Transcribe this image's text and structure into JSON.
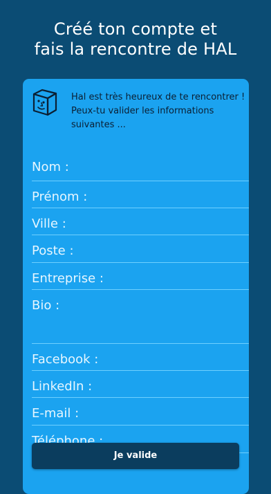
{
  "header": {
    "line1": "Créé ton compte et",
    "line2": "fais la rencontre de HAL"
  },
  "card": {
    "icon": "hal-cube-face-icon",
    "intro": "Hal est très heureux de te rencontrer ! Peux-tu valider les informations suivantes ...",
    "fields": [
      {
        "label": "Nom :",
        "value": ""
      },
      {
        "label": "Prénom :",
        "value": ""
      },
      {
        "label": "Ville :",
        "value": ""
      },
      {
        "label": "Poste :",
        "value": ""
      },
      {
        "label": "Entreprise :",
        "value": ""
      },
      {
        "label": "Bio :",
        "value": ""
      },
      {
        "label": "Facebook :",
        "value": ""
      },
      {
        "label": "LinkedIn :",
        "value": ""
      },
      {
        "label": "E-mail :",
        "value": ""
      },
      {
        "label": "Téléphone :",
        "value": ""
      }
    ]
  },
  "submit": {
    "label": "Je valide"
  },
  "colors": {
    "background": "#0b4c74",
    "card": "#1ba3f0",
    "button": "#0b3d5e",
    "divider": "#6fd0ff"
  }
}
